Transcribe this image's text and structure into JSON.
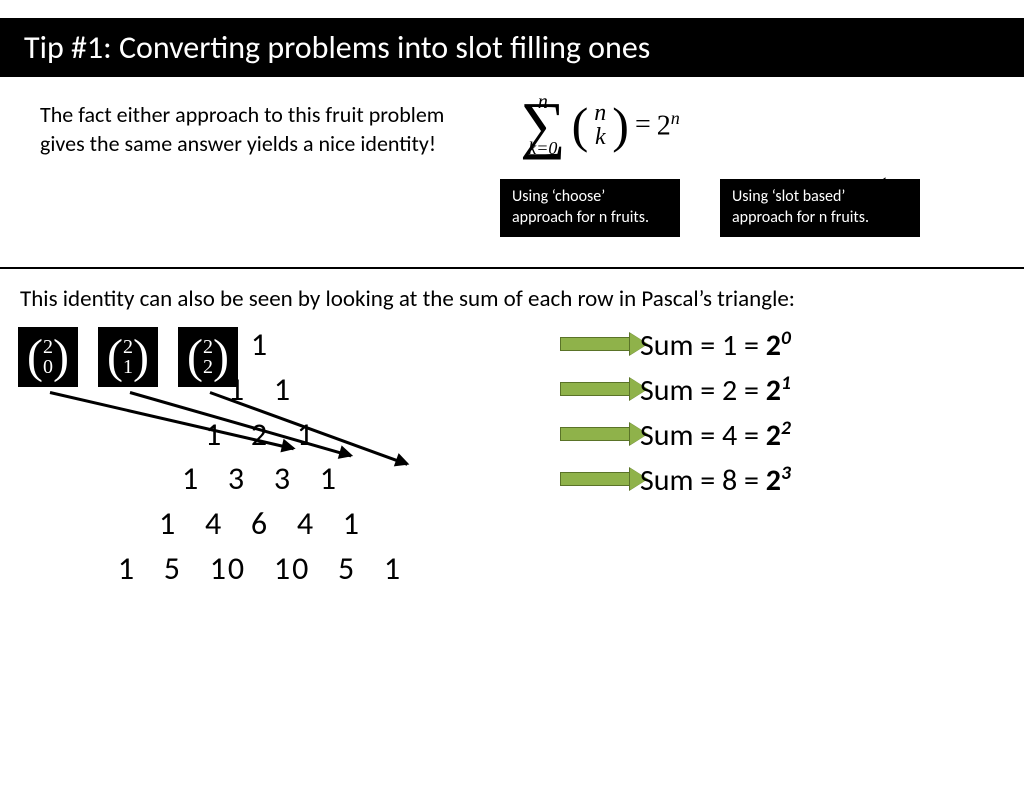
{
  "title": "Tip #1: Converting problems into slot filling ones",
  "intro": "The fact either approach to this fruit problem gives the same answer yields a nice identity!",
  "formula": {
    "sigma_upper": "n",
    "sigma_lower": "k=0",
    "binom_top": "n",
    "binom_bot": "k",
    "equals": " = ",
    "rhs_base": "2",
    "rhs_exp": "n"
  },
  "box_left": "Using ‘choose’ approach for n fruits.",
  "box_right": "Using ‘slot based’ approach for n fruits.",
  "subtext": "This identity can also be seen by looking at the sum of each row in Pascal’s triangle:",
  "choose_boxes": [
    {
      "top": "2",
      "bot": "0"
    },
    {
      "top": "2",
      "bot": "1"
    },
    {
      "top": "2",
      "bot": "2"
    }
  ],
  "pascal_rows": [
    "1",
    "1   1",
    "1   2   1",
    "1   3   3   1",
    "1   4   6   4   1",
    "1   5   10   10   5   1"
  ],
  "sums": [
    {
      "prefix": "Sum = 1 = ",
      "base": "2",
      "exp": "0"
    },
    {
      "prefix": "Sum = 2 = ",
      "base": "2",
      "exp": "1"
    },
    {
      "prefix": "Sum = 4 = ",
      "base": "2",
      "exp": "2"
    },
    {
      "prefix": "Sum = 8 = ",
      "base": "2",
      "exp": "3"
    }
  ]
}
